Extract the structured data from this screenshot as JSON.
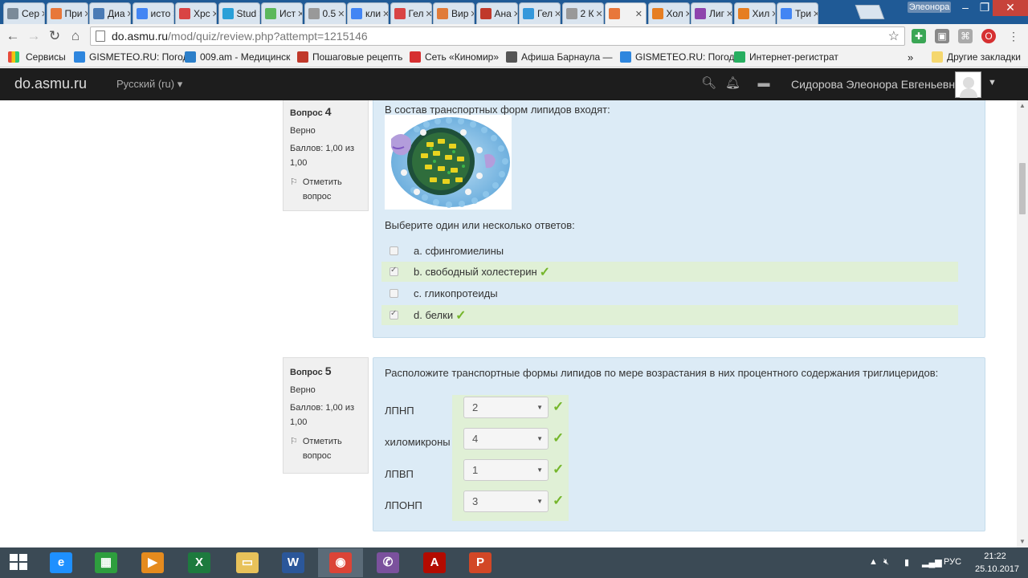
{
  "browser": {
    "tabs": [
      {
        "label": "Сер",
        "color": "#7a8a99",
        "icon": "play-icon"
      },
      {
        "label": "При",
        "color": "#e8773a",
        "icon": "f-icon"
      },
      {
        "label": "Диа",
        "color": "#4a7bb5",
        "icon": "square-icon"
      },
      {
        "label": "исто",
        "color": "#4285f4",
        "icon": "google-icon"
      },
      {
        "label": "Хрс",
        "color": "#d94444",
        "icon": "pulse-icon"
      },
      {
        "label": "Stud",
        "color": "#2aa0d8",
        "icon": "s-icon"
      },
      {
        "label": "Ист",
        "color": "#5cb85c",
        "icon": "book-icon"
      },
      {
        "label": "0.5",
        "color": "#999999",
        "icon": "page-icon"
      },
      {
        "label": "кли",
        "color": "#4285f4",
        "icon": "google-icon"
      },
      {
        "label": "Гел",
        "color": "#d94444",
        "icon": "cross-icon"
      },
      {
        "label": "Вир",
        "color": "#e07b39",
        "icon": "doc-icon"
      },
      {
        "label": "Ана",
        "color": "#c0392b",
        "icon": "star-icon"
      },
      {
        "label": "Гел",
        "color": "#3498db",
        "icon": "globe-icon"
      },
      {
        "label": "2 К",
        "color": "#999999",
        "icon": "page-icon"
      },
      {
        "label": "",
        "color": "#e8773a",
        "icon": "moodle-icon"
      },
      {
        "label": "Хол",
        "color": "#e67e22",
        "icon": "cone-icon"
      },
      {
        "label": "Лиг",
        "color": "#8e44ad",
        "icon": "w-icon"
      },
      {
        "label": "Хил",
        "color": "#e67e22",
        "icon": "cone-icon"
      },
      {
        "label": "Три",
        "color": "#4285f4",
        "icon": "google-icon"
      }
    ],
    "profile_name": "Элеонора",
    "url_host": "do.asmu.ru",
    "url_path": "/mod/quiz/review.php?attempt=1215146",
    "bookmarks": [
      {
        "label": "Сервисы",
        "color": "#e74c3c"
      },
      {
        "label": "GISMETEO.RU: Погод",
        "color": "#2e86de"
      },
      {
        "label": "009.am - Медицинск",
        "color": "#2c7fc9"
      },
      {
        "label": "Пошаговые рецепть",
        "color": "#c0392b"
      },
      {
        "label": "Сеть «Киномир»",
        "color": "#d63031"
      },
      {
        "label": "Афиша Барнаула —",
        "color": "#555555"
      },
      {
        "label": "GISMETEO.RU: Погод",
        "color": "#2e86de"
      },
      {
        "label": "Интернет-регистрат",
        "color": "#27ae60"
      }
    ],
    "bookmarks_more": "»",
    "other_bookmarks": "Другие закладки"
  },
  "navbar": {
    "brand": "do.asmu.ru",
    "language": "Русский (ru)",
    "username": "Сидорова Элеонора Евгеньевна"
  },
  "questions": [
    {
      "number_prefix": "Вопрос",
      "number": "4",
      "state": "Верно",
      "grade_line1": "Баллов: 1,00 из",
      "grade_line2": "1,00",
      "flag_line1": "Отметить",
      "flag_line2": "вопрос",
      "text": "В состав транспортных форм липидов входят:",
      "prompt": "Выберите один или несколько ответов:",
      "answers": [
        {
          "label": "a. сфингомиелины",
          "checked": false,
          "correct": false
        },
        {
          "label": "b. свободный холестерин",
          "checked": true,
          "correct": true
        },
        {
          "label": "c. гликопротеиды",
          "checked": false,
          "correct": false
        },
        {
          "label": "d. белки",
          "checked": true,
          "correct": true
        }
      ]
    },
    {
      "number_prefix": "Вопрос",
      "number": "5",
      "state": "Верно",
      "grade_line1": "Баллов: 1,00 из",
      "grade_line2": "1,00",
      "flag_line1": "Отметить",
      "flag_line2": "вопрос",
      "text": "Расположите транспортные формы липидов по мере возрастания в них процентного содержания триглицеридов:",
      "matches": [
        {
          "label": "ЛПНП",
          "value": "2"
        },
        {
          "label": "хиломикроны",
          "value": "4"
        },
        {
          "label": "ЛПВП",
          "value": "1"
        },
        {
          "label": "ЛПОНП",
          "value": "3"
        }
      ]
    }
  ],
  "taskbar": {
    "apps": [
      {
        "name": "ie",
        "glyph": "e",
        "color": "#1e90ff"
      },
      {
        "name": "store",
        "glyph": "▦",
        "color": "#2e9e3e"
      },
      {
        "name": "media",
        "glyph": "▶",
        "color": "#e58b1e"
      },
      {
        "name": "excel",
        "glyph": "X",
        "color": "#1d7a3e"
      },
      {
        "name": "explorer",
        "glyph": "▭",
        "color": "#e8c25a"
      },
      {
        "name": "word",
        "glyph": "W",
        "color": "#2b579a"
      },
      {
        "name": "chrome",
        "glyph": "◉",
        "color": "#db4437"
      },
      {
        "name": "viber",
        "glyph": "✆",
        "color": "#7b519d"
      },
      {
        "name": "acrobat",
        "glyph": "A",
        "color": "#b30b00"
      },
      {
        "name": "powerpoint",
        "glyph": "P",
        "color": "#d24726"
      }
    ],
    "lang": "РУС",
    "time": "21:22",
    "date": "25.10.2017"
  }
}
